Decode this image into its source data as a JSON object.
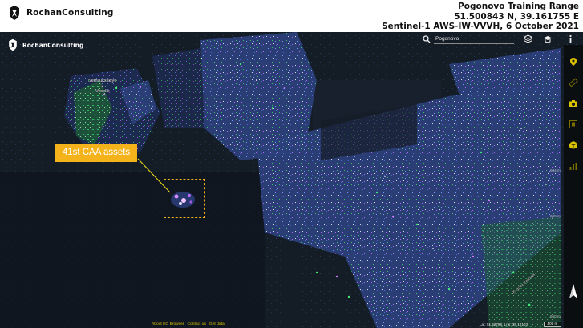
{
  "header": {
    "brand": "RochanConsulting",
    "title_line1": "Pogonovo Training Range",
    "title_line2": "51.500843 N, 39.161755 E",
    "title_line3": "Sentinel-1 AWS-IW-VVVH, 6  October 2021"
  },
  "map": {
    "watermark": "RochanConsulting",
    "place_line1": "Semiluksskiye",
    "place_line2": "Vyselki",
    "annotation_label": "41st CAA assets",
    "road_label": "Rostovo Vpadina",
    "scale_tick_upper": "604 m",
    "scale_tick_lower": "605 m",
    "scale_tick_right": "660 m",
    "colors": {
      "callout": "#f4b31a",
      "sar_green": "#2fd05a",
      "sar_magenta": "#c66cff",
      "sar_blue": "#3f5fb8",
      "toolbar_accent": "#d9c200"
    }
  },
  "toolbar": {
    "search_value": "Pogonovo",
    "search_icon": "search-icon",
    "top_icons": [
      "layers-icon",
      "education-icon",
      "info-icon"
    ],
    "side_tools": [
      "location-pin-icon",
      "ruler-icon",
      "camera-icon",
      "film-icon",
      "cube-icon",
      "bar-chart-icon"
    ]
  },
  "footer": {
    "link_about": "About EO Browser",
    "link_contact": "Contact us",
    "link_data": "Get data",
    "latlng": "Lat: 51.52788, Lng: 39.12103",
    "scale": "500 m"
  }
}
